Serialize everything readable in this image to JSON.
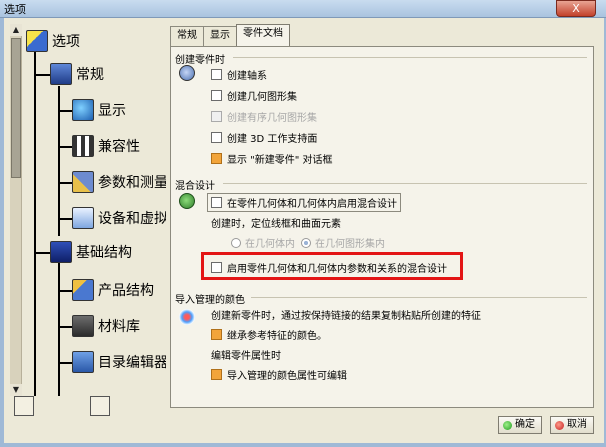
{
  "window": {
    "title": "选项",
    "close_label": "X"
  },
  "tree": {
    "items": [
      {
        "label": "选项"
      },
      {
        "label": "常规"
      },
      {
        "label": "显示"
      },
      {
        "label": "兼容性"
      },
      {
        "label": "参数和测量"
      },
      {
        "label": "设备和虚拟现"
      },
      {
        "label": "基础结构"
      },
      {
        "label": "产品结构"
      },
      {
        "label": "材料库"
      },
      {
        "label": "目录编辑器"
      }
    ],
    "scroll_up": "▲",
    "scroll_down": "▼"
  },
  "tabs": [
    {
      "label": "常规"
    },
    {
      "label": "显示"
    },
    {
      "label": "零件文档",
      "active": true
    }
  ],
  "sections": {
    "create_part": {
      "title": "创建零件时",
      "options": [
        {
          "label": "创建轴系",
          "checked": false
        },
        {
          "label": "创建几何图形集",
          "checked": false
        },
        {
          "label": "创建有序几何图形集",
          "checked": false,
          "disabled": true
        },
        {
          "label": "创建 3D 工作支持面",
          "checked": false
        },
        {
          "label": "显示 \"新建零件\" 对话框",
          "checked": true
        }
      ]
    },
    "hybrid": {
      "title": "混合设计",
      "option1": "在零件几何体和几何体内启用混合设计",
      "subtitle": "创建时，定位线框和曲面元素",
      "radio1": "在几何体内",
      "radio2": "在几何图形集内",
      "option2": "启用零件几何体和几何体内参数和关系的混合设计"
    },
    "import_color": {
      "title": "导入管理的颜色",
      "desc": "创建新零件时，通过按保持链接的结果复制粘贴所创建的特征",
      "option1": "继承参考特征的颜色。",
      "subtitle2": "编辑零件属性时",
      "option2": "导入管理的颜色属性可编辑"
    }
  },
  "buttons": {
    "ok": "确定",
    "cancel": "取消"
  },
  "colors": {
    "highlight": "#e31515",
    "checked": "#f2a43a"
  }
}
